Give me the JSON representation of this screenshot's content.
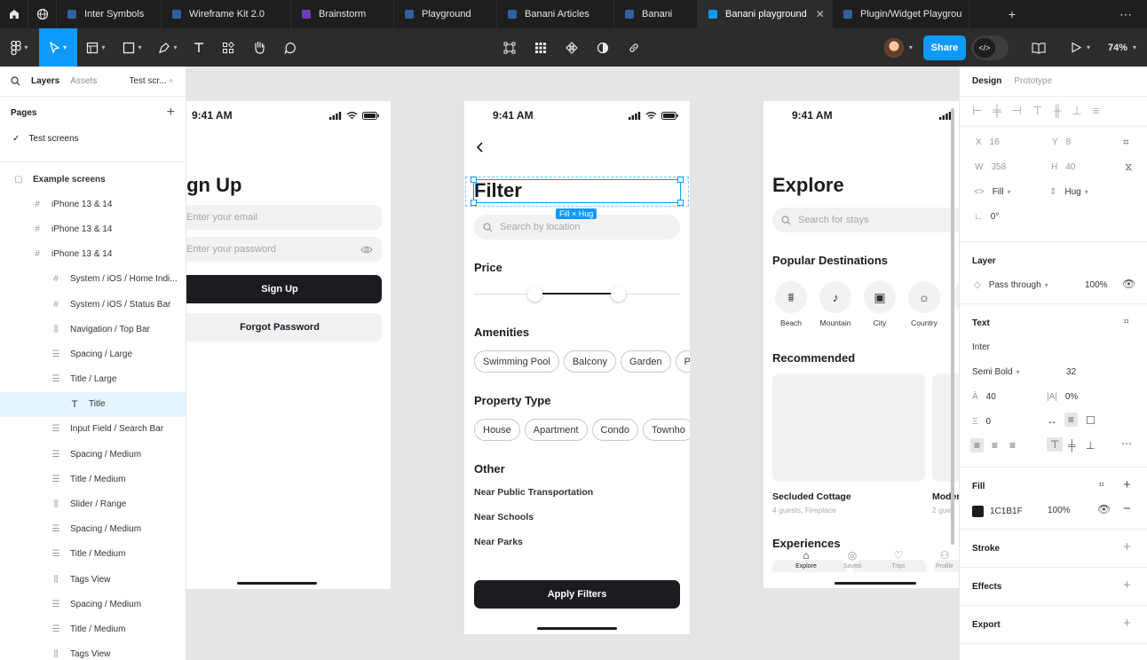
{
  "tabs": [
    {
      "label": "Inter Symbols",
      "icon": "figma-file-icon",
      "active": false,
      "width": 118
    },
    {
      "label": "Wireframe Kit 2.0",
      "icon": "figma-file-icon",
      "active": false,
      "width": 146
    },
    {
      "label": "Brainstorm",
      "icon": "figjam-file-icon",
      "active": false,
      "width": 116
    },
    {
      "label": "Playground",
      "icon": "figma-file-icon",
      "active": false,
      "width": 116
    },
    {
      "label": "Banani Articles",
      "icon": "figma-file-icon",
      "active": false,
      "width": 132
    },
    {
      "label": "Banani",
      "icon": "figma-file-icon",
      "active": false,
      "width": 94
    },
    {
      "label": "Banani playground",
      "icon": "figma-file-icon",
      "active": true,
      "width": 152
    },
    {
      "label": "Plugin/Widget Playgrou",
      "icon": "figma-file-icon",
      "active": false,
      "width": 154
    }
  ],
  "toolbar": {
    "share_label": "Share",
    "zoom": "74%",
    "dev_mode": "</>"
  },
  "left_panel": {
    "tab_layers": "Layers",
    "tab_assets": "Assets",
    "page_selector": "Test scr...",
    "pages_heading": "Pages",
    "current_page": "Test screens",
    "layers": [
      {
        "label": "Example screens",
        "icon": "section-icon",
        "indent": 0,
        "selected": false
      },
      {
        "label": "iPhone 13 & 14",
        "icon": "frame-icon",
        "indent": 1,
        "selected": false
      },
      {
        "label": "iPhone 13 & 14",
        "icon": "frame-icon",
        "indent": 1,
        "selected": false
      },
      {
        "label": "iPhone 13 & 14",
        "icon": "frame-icon",
        "indent": 1,
        "selected": false
      },
      {
        "label": "System / iOS / Home Indi...",
        "icon": "frame-icon",
        "indent": 2,
        "selected": false
      },
      {
        "label": "System / iOS / Status Bar",
        "icon": "frame-icon",
        "indent": 2,
        "selected": false
      },
      {
        "label": "Navigation / Top Bar",
        "icon": "autolayout-h-icon",
        "indent": 2,
        "selected": false
      },
      {
        "label": "Spacing / Large",
        "icon": "autolayout-v-icon",
        "indent": 2,
        "selected": false
      },
      {
        "label": "Title / Large",
        "icon": "autolayout-v-icon",
        "indent": 2,
        "selected": false
      },
      {
        "label": "Title",
        "icon": "text-icon",
        "indent": 3,
        "selected": true
      },
      {
        "label": "Input Field / Search Bar",
        "icon": "autolayout-v-icon",
        "indent": 2,
        "selected": false
      },
      {
        "label": "Spacing / Medium",
        "icon": "autolayout-v-icon",
        "indent": 2,
        "selected": false
      },
      {
        "label": "Title / Medium",
        "icon": "autolayout-v-icon",
        "indent": 2,
        "selected": false
      },
      {
        "label": "Slider / Range",
        "icon": "autolayout-h-icon",
        "indent": 2,
        "selected": false
      },
      {
        "label": "Spacing / Medium",
        "icon": "autolayout-v-icon",
        "indent": 2,
        "selected": false
      },
      {
        "label": "Title / Medium",
        "icon": "autolayout-v-icon",
        "indent": 2,
        "selected": false
      },
      {
        "label": "Tags View",
        "icon": "autolayout-h-icon",
        "indent": 2,
        "selected": false
      },
      {
        "label": "Spacing / Medium",
        "icon": "autolayout-v-icon",
        "indent": 2,
        "selected": false
      },
      {
        "label": "Title / Medium",
        "icon": "autolayout-v-icon",
        "indent": 2,
        "selected": false
      },
      {
        "label": "Tags View",
        "icon": "autolayout-h-icon",
        "indent": 2,
        "selected": false
      }
    ]
  },
  "canvas": {
    "signup": {
      "time": "9:41 AM",
      "title": "ign Up",
      "email_placeholder": "Enter your email",
      "password_placeholder": "Enter your password",
      "signup_button": "Sign Up",
      "forgot_button": "Forgot Password"
    },
    "filter": {
      "time": "9:41 AM",
      "title": "Filter",
      "selection_label": "Fill × Hug",
      "search_placeholder": "Search by location",
      "price_title": "Price",
      "amenities_title": "Amenities",
      "amenities": [
        "Swimming Pool",
        "Balcony",
        "Garden",
        "P"
      ],
      "property_title": "Property Type",
      "property_types": [
        "House",
        "Apartment",
        "Condo",
        "Townho"
      ],
      "other_title": "Other",
      "other_items": [
        "Near Public Transportation",
        "Near Schools",
        "Near Parks"
      ],
      "apply_button": "Apply Filters"
    },
    "explore": {
      "time": "9:41 AM",
      "title": "Explore",
      "search_placeholder": "Search for stays",
      "popular_title": "Popular Destinations",
      "destinations": [
        {
          "label": "Beach",
          "icon": "beach-icon"
        },
        {
          "label": "Mountain",
          "icon": "mountain-icon"
        },
        {
          "label": "City",
          "icon": "city-icon"
        },
        {
          "label": "Country",
          "icon": "sun-icon"
        },
        {
          "label": "L",
          "icon": "lake-icon"
        }
      ],
      "recommended_title": "Recommended",
      "card1_title": "Secluded Cottage",
      "card1_sub": "4 guests, Fireplace",
      "card2_title": "Moder",
      "card2_sub": "2 gues",
      "experiences_title": "Experiences",
      "nav": [
        {
          "label": "Explore",
          "icon": "home-icon",
          "active": true
        },
        {
          "label": "Saved",
          "icon": "compass-icon",
          "active": false
        },
        {
          "label": "Trips",
          "icon": "heart-icon",
          "active": false
        },
        {
          "label": "Profile",
          "icon": "profile-icon",
          "active": false
        }
      ]
    }
  },
  "right_panel": {
    "tab_design": "Design",
    "tab_prototype": "Prototype",
    "x_label": "X",
    "x": "16",
    "y_label": "Y",
    "y": "8",
    "w_label": "W",
    "w": "358",
    "h_label": "H",
    "h": "40",
    "w_sizing": "Fill",
    "h_sizing": "Hug",
    "rotation": "0°",
    "layer_heading": "Layer",
    "blend_mode": "Pass through",
    "opacity": "100%",
    "text_heading": "Text",
    "font_family": "Inter",
    "font_weight": "Semi Bold",
    "font_size": "32",
    "line_height": "40",
    "letter_spacing": "0%",
    "paragraph_spacing": "0",
    "fill_heading": "Fill",
    "fill_hex": "1C1B1F",
    "fill_opacity": "100%",
    "stroke_heading": "Stroke",
    "effects_heading": "Effects",
    "export_heading": "Export"
  },
  "colors": {
    "accent": "#0d99ff",
    "text": "#1c1b1f",
    "toolbar": "#2c2c2c",
    "tabbar": "#1e1e1e"
  }
}
